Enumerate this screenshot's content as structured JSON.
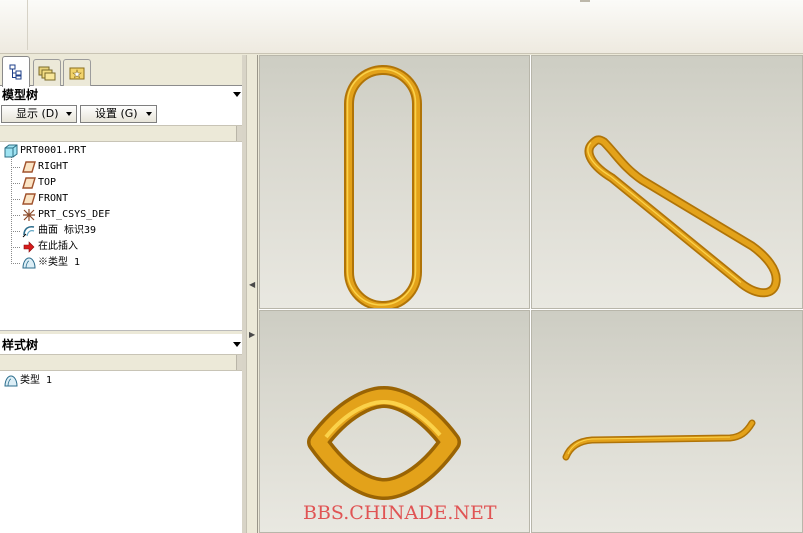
{
  "nav_tabs": [
    {
      "name": "model-tree-tab",
      "icon": "model-tree-icon",
      "active": true
    },
    {
      "name": "folder-browser-tab",
      "icon": "folder-browser-icon",
      "active": false
    },
    {
      "name": "favorites-tab",
      "icon": "favorites-icon",
      "active": false
    }
  ],
  "model_tree": {
    "title": "模型树",
    "show_button": "显示 (D)",
    "settings_button": "设置 (G)",
    "items": [
      {
        "label": "PRT0001.PRT",
        "icon": "part-icon"
      },
      {
        "label": "RIGHT",
        "icon": "datum-plane-icon"
      },
      {
        "label": "TOP",
        "icon": "datum-plane-icon"
      },
      {
        "label": "FRONT",
        "icon": "datum-plane-icon"
      },
      {
        "label": "PRT_CSYS_DEF",
        "icon": "coordinate-system-icon"
      },
      {
        "label": "曲面 标识39",
        "icon": "surface-icon"
      },
      {
        "label": "在此插入",
        "icon": "insert-here-arrow-icon"
      },
      {
        "label": "※类型 1",
        "icon": "style-feature-icon"
      }
    ]
  },
  "style_tree": {
    "title": "样式树",
    "items": [
      {
        "label": "类型 1",
        "icon": "style-feature-icon"
      }
    ]
  },
  "colors": {
    "curve_gold": "#e3a21a",
    "curve_dark": "#b07408",
    "curve_light": "#fbd24a",
    "watermark": "#e05454"
  },
  "watermark": "BBS.CHINADE.NET"
}
